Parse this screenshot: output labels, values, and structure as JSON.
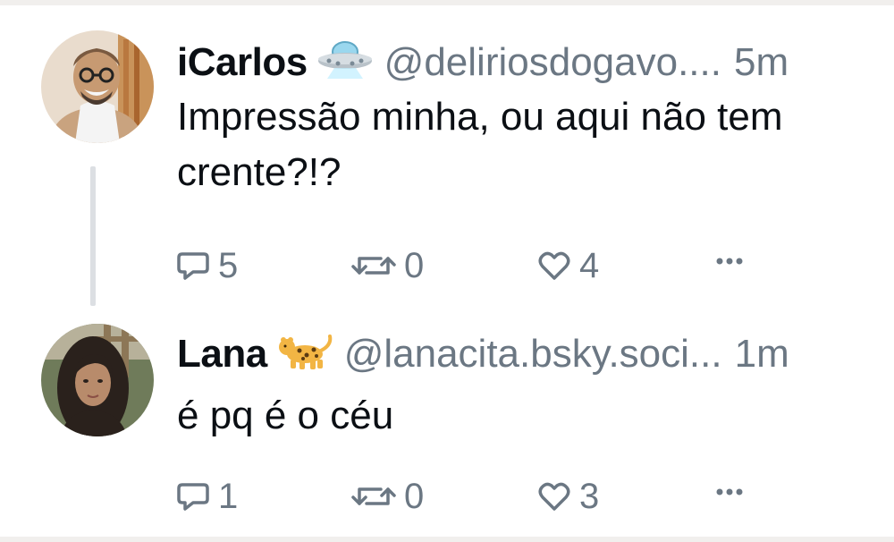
{
  "posts": [
    {
      "author_name": "iCarlos",
      "author_emoji_icon": "ufo-emoji",
      "handle": "@deliriosdogavo....",
      "time": "5m",
      "text": "Impressão minha, ou aqui não tem crente?!?",
      "replies": "5",
      "reposts": "0",
      "likes": "4"
    },
    {
      "author_name": "Lana",
      "author_emoji_icon": "leopard-emoji",
      "handle": "@lanacita.bsky.soci...",
      "time": "1m",
      "text": "é pq é o céu",
      "replies": "1",
      "reposts": "0",
      "likes": "3"
    }
  ],
  "icons": {
    "reply": "speech-bubble-icon",
    "repost": "repost-arrows-icon",
    "like": "heart-icon",
    "more": "ellipsis-icon"
  },
  "colors": {
    "text": "#0b0f14",
    "muted": "#6b7783",
    "thread_line": "#dcdfe3",
    "background": "#ffffff"
  }
}
